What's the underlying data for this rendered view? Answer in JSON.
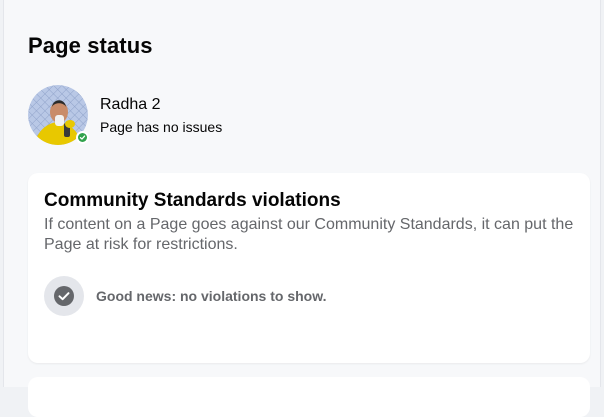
{
  "page_status": {
    "title": "Page status",
    "page": {
      "name": "Radha 2",
      "status": "Page has no issues"
    }
  },
  "community_standards": {
    "title": "Community Standards violations",
    "description": "If content on a Page goes against our Community Standards, it can put the Page at risk for restrictions.",
    "result": "Good news: no violations to show.",
    "result_icon": "check-circle-icon"
  },
  "colors": {
    "status_green": "#31a24c",
    "secondary_text": "#65676b"
  }
}
